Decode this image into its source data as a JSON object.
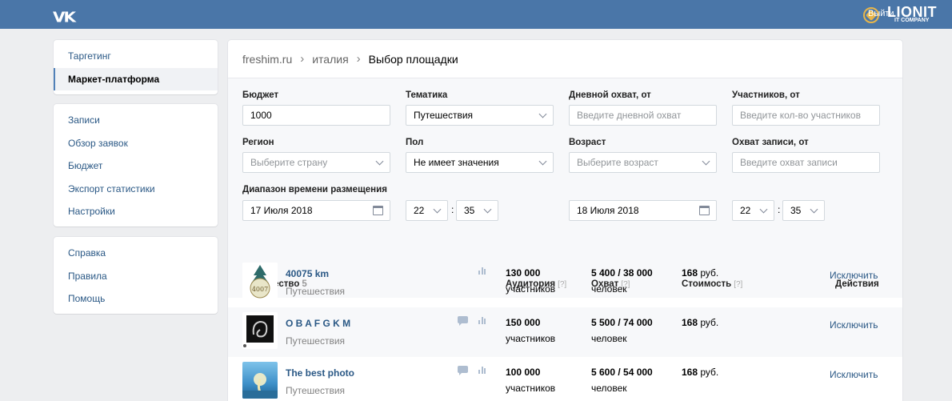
{
  "header": {
    "logo": "VK",
    "exit_label": "Выйти",
    "brand": "LIONIT",
    "brand_sub": "IT COMPANY"
  },
  "nav": {
    "group1": [
      {
        "label": "Таргетинг",
        "active": false
      },
      {
        "label": "Маркет-платформа",
        "active": true
      }
    ],
    "group2": [
      {
        "label": "Записи"
      },
      {
        "label": "Обзор заявок"
      },
      {
        "label": "Бюджет"
      },
      {
        "label": "Экспорт статистики"
      },
      {
        "label": "Настройки"
      }
    ],
    "group3": [
      {
        "label": "Справка"
      },
      {
        "label": "Правила"
      },
      {
        "label": "Помощь"
      }
    ]
  },
  "breadcrumb": [
    "freshim.ru",
    "италия",
    "Выбор площадки"
  ],
  "filters": {
    "budget": {
      "label": "Бюджет",
      "value": "1000"
    },
    "topic": {
      "label": "Тематика",
      "value": "Путешествия"
    },
    "daily_reach": {
      "label": "Дневной охват, от",
      "placeholder": "Введите дневной охват"
    },
    "members": {
      "label": "Участников, от",
      "placeholder": "Введите кол-во участников"
    },
    "region": {
      "label": "Регион",
      "placeholder": "Выберите страну"
    },
    "gender": {
      "label": "Пол",
      "value": "Не имеет значения"
    },
    "age": {
      "label": "Возраст",
      "placeholder": "Выберите возраст"
    },
    "post_reach": {
      "label": "Охват записи, от",
      "placeholder": "Введите охват записи"
    },
    "time_range": {
      "label": "Диапазон времени размещения",
      "from_date": "17 Июля 2018",
      "from_hour": "22",
      "from_min": "35",
      "to_date": "18 Июля 2018",
      "to_hour": "22",
      "to_min": "35",
      "separator": ":"
    }
  },
  "table": {
    "headers": {
      "community": "Сообщество",
      "community_count": "5",
      "audience": "Аудитория",
      "reach": "Охват",
      "cost": "Стоимость",
      "actions": "Действия",
      "help_mark": "[?]"
    },
    "rows": [
      {
        "name": "40075 km",
        "topic": "Путешествия",
        "audience": "130 000",
        "audience_unit": "участников",
        "reach": "5 400 / 38 000",
        "reach_unit": "человек",
        "cost": "168",
        "cost_unit": "руб.",
        "action": "Исключить",
        "has_msg": false
      },
      {
        "name": "O B A F G K M",
        "topic": "Путешествия",
        "audience": "150 000",
        "audience_unit": "участников",
        "reach": "5 500 / 74 000",
        "reach_unit": "человек",
        "cost": "168",
        "cost_unit": "руб.",
        "action": "Исключить",
        "has_msg": true
      },
      {
        "name": "The best photo",
        "topic": "Путешествия",
        "audience": "100 000",
        "audience_unit": "участников",
        "reach": "5 600 / 54 000",
        "reach_unit": "человек",
        "cost": "168",
        "cost_unit": "руб.",
        "action": "Исключить",
        "has_msg": true
      }
    ]
  },
  "colors": {
    "header_bg": "#4a76a8",
    "link": "#2a5885",
    "accent": "#5181b8"
  }
}
